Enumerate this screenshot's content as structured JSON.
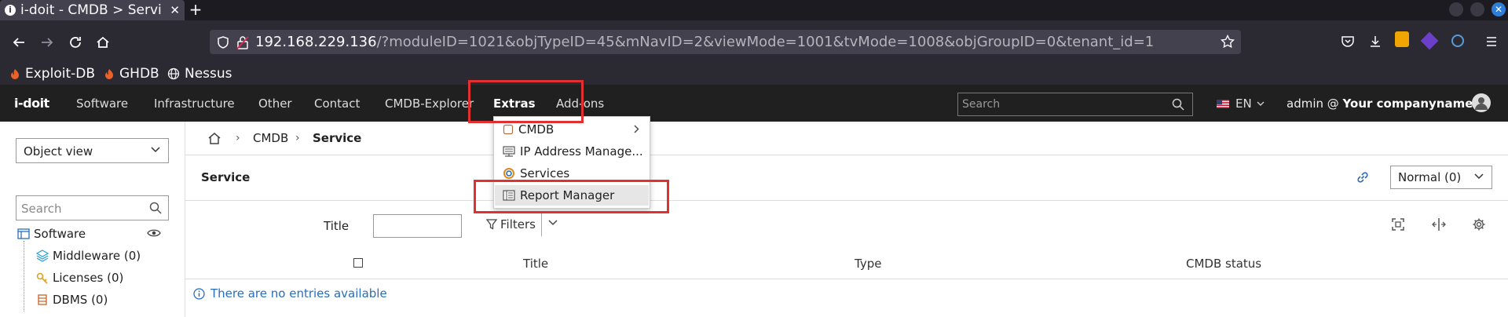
{
  "browser": {
    "tab_title": "i-doit - CMDB > Servi",
    "new_tab": "+",
    "url_host": "192.168.229.136",
    "url_path": "/?moduleID=1021&objTypeID=45&mNavID=2&viewMode=1001&tvMode=1008&objGroupID=0&tenant_id=1",
    "bookmarks": [
      "Exploit-DB",
      "GHDB",
      "Nessus"
    ]
  },
  "app": {
    "logo": "i-doit",
    "nav": [
      "Software",
      "Infrastructure",
      "Other",
      "Contact",
      "CMDB-Explorer",
      "Extras",
      "Add-ons"
    ],
    "search_placeholder": "Search",
    "language": "EN",
    "user_prefix": "admin @ ",
    "user_company": "Your companyname"
  },
  "left": {
    "view_select": "Object view",
    "search_placeholder": "Search",
    "tree": [
      {
        "label": "Software"
      },
      {
        "label": "Middleware (0)"
      },
      {
        "label": "Licenses (0)"
      },
      {
        "label": "DBMS (0)"
      }
    ]
  },
  "main": {
    "breadcrumb": [
      "CMDB",
      "Service"
    ],
    "page_title": "Service",
    "status_select": "Normal (0)",
    "filter_title_label": "Title",
    "filters_label": "Filters",
    "columns": [
      "Title",
      "Type",
      "CMDB status"
    ],
    "empty_message": "There are no entries available"
  },
  "dropdown": {
    "items": [
      "CMDB",
      "IP Address Manage...",
      "Services",
      "Report Manager"
    ]
  },
  "colors": {
    "header_bg": "#202020",
    "accent": "#2a6ebb",
    "highlight": "#e03030"
  }
}
